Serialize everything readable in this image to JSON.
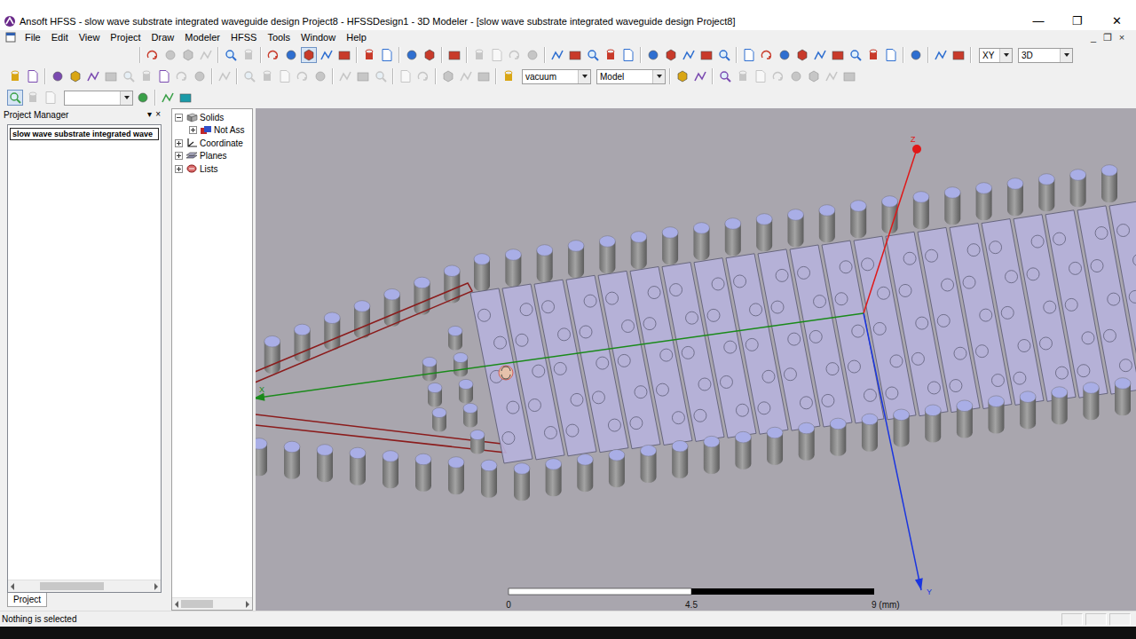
{
  "window": {
    "title": "Ansoft HFSS - slow wave substrate integrated waveguide design Project8 - HFSSDesign1 - 3D Modeler - [slow wave substrate integrated waveguide design Project8]",
    "controls": [
      "—",
      "❐",
      "✕"
    ]
  },
  "menu": {
    "items": [
      "File",
      "Edit",
      "View",
      "Project",
      "Draw",
      "Modeler",
      "HFSS",
      "Tools",
      "Window",
      "Help"
    ],
    "controls": [
      "_",
      "❐",
      "×"
    ]
  },
  "toolbars": [
    {
      "items": [
        {
          "kind": "separator"
        },
        {
          "kind": "button",
          "disabled": false,
          "pressed": false
        },
        {
          "kind": "button",
          "disabled": true,
          "pressed": false
        },
        {
          "kind": "button",
          "disabled": true,
          "pressed": false
        },
        {
          "kind": "button",
          "disabled": true,
          "pressed": false
        },
        {
          "kind": "separator"
        },
        {
          "kind": "button",
          "disabled": false,
          "pressed": false
        },
        {
          "kind": "button",
          "disabled": true,
          "pressed": false
        },
        {
          "kind": "separator"
        },
        {
          "kind": "button",
          "disabled": false,
          "pressed": false
        },
        {
          "kind": "button",
          "disabled": false,
          "pressed": false
        },
        {
          "kind": "button",
          "disabled": false,
          "pressed": true
        },
        {
          "kind": "button",
          "disabled": false,
          "pressed": false
        },
        {
          "kind": "button",
          "disabled": false,
          "pressed": false
        },
        {
          "kind": "separator"
        },
        {
          "kind": "button",
          "disabled": false,
          "pressed": false
        },
        {
          "kind": "button",
          "disabled": false,
          "pressed": false
        },
        {
          "kind": "separator"
        },
        {
          "kind": "button",
          "disabled": false,
          "pressed": false
        },
        {
          "kind": "button",
          "disabled": false,
          "pressed": false
        },
        {
          "kind": "separator"
        },
        {
          "kind": "button",
          "disabled": false,
          "pressed": false
        },
        {
          "kind": "separator"
        },
        {
          "kind": "button",
          "disabled": true,
          "pressed": false
        },
        {
          "kind": "button",
          "disabled": true,
          "pressed": false
        },
        {
          "kind": "button",
          "disabled": true,
          "pressed": false
        },
        {
          "kind": "button",
          "disabled": true,
          "pressed": false
        },
        {
          "kind": "separator"
        },
        {
          "kind": "button",
          "disabled": false,
          "pressed": false
        },
        {
          "kind": "button",
          "disabled": false,
          "pressed": false
        },
        {
          "kind": "button",
          "disabled": false,
          "pressed": false
        },
        {
          "kind": "button",
          "disabled": false,
          "pressed": false
        },
        {
          "kind": "button",
          "disabled": false,
          "pressed": false
        },
        {
          "kind": "separator"
        },
        {
          "kind": "button",
          "disabled": false,
          "pressed": false
        },
        {
          "kind": "button",
          "disabled": false,
          "pressed": false
        },
        {
          "kind": "button",
          "disabled": false,
          "pressed": false
        },
        {
          "kind": "button",
          "disabled": false,
          "pressed": false
        },
        {
          "kind": "button",
          "disabled": false,
          "pressed": false
        },
        {
          "kind": "separator"
        },
        {
          "kind": "button",
          "disabled": false,
          "pressed": false
        },
        {
          "kind": "button",
          "disabled": false,
          "pressed": false
        },
        {
          "kind": "button",
          "disabled": false,
          "pressed": false
        },
        {
          "kind": "button",
          "disabled": false,
          "pressed": false
        },
        {
          "kind": "button",
          "disabled": false,
          "pressed": false
        },
        {
          "kind": "button",
          "disabled": false,
          "pressed": false
        },
        {
          "kind": "button",
          "disabled": false,
          "pressed": false
        },
        {
          "kind": "button",
          "disabled": false,
          "pressed": false
        },
        {
          "kind": "button",
          "disabled": false,
          "pressed": false
        },
        {
          "kind": "separator"
        },
        {
          "kind": "button",
          "disabled": false,
          "pressed": false
        },
        {
          "kind": "separator"
        },
        {
          "kind": "button",
          "disabled": false,
          "pressed": false
        },
        {
          "kind": "button",
          "disabled": false,
          "pressed": false
        },
        {
          "kind": "separator"
        },
        {
          "kind": "dropdown",
          "value": "XY"
        },
        {
          "kind": "dropdown",
          "value": "3D"
        }
      ]
    },
    {
      "items": [
        {
          "kind": "button",
          "disabled": false,
          "pressed": false
        },
        {
          "kind": "button",
          "disabled": false,
          "pressed": false
        },
        {
          "kind": "separator"
        },
        {
          "kind": "button",
          "disabled": false,
          "pressed": false
        },
        {
          "kind": "button",
          "disabled": false,
          "pressed": false
        },
        {
          "kind": "button",
          "disabled": false,
          "pressed": false
        },
        {
          "kind": "button",
          "disabled": true,
          "pressed": false
        },
        {
          "kind": "button",
          "disabled": true,
          "pressed": false
        },
        {
          "kind": "button",
          "disabled": true,
          "pressed": false
        },
        {
          "kind": "button",
          "disabled": false,
          "pressed": false
        },
        {
          "kind": "button",
          "disabled": true,
          "pressed": false
        },
        {
          "kind": "button",
          "disabled": true,
          "pressed": false
        },
        {
          "kind": "separator"
        },
        {
          "kind": "button",
          "disabled": true,
          "pressed": false
        },
        {
          "kind": "separator"
        },
        {
          "kind": "button",
          "disabled": true,
          "pressed": false
        },
        {
          "kind": "button",
          "disabled": true,
          "pressed": false
        },
        {
          "kind": "button",
          "disabled": true,
          "pressed": false
        },
        {
          "kind": "button",
          "disabled": true,
          "pressed": false
        },
        {
          "kind": "button",
          "disabled": true,
          "pressed": false
        },
        {
          "kind": "separator"
        },
        {
          "kind": "button",
          "disabled": true,
          "pressed": false
        },
        {
          "kind": "button",
          "disabled": true,
          "pressed": false
        },
        {
          "kind": "button",
          "disabled": true,
          "pressed": false
        },
        {
          "kind": "separator"
        },
        {
          "kind": "button",
          "disabled": true,
          "pressed": false
        },
        {
          "kind": "button",
          "disabled": true,
          "pressed": false
        },
        {
          "kind": "separator"
        },
        {
          "kind": "button",
          "disabled": true,
          "pressed": false
        },
        {
          "kind": "button",
          "disabled": true,
          "pressed": false
        },
        {
          "kind": "button",
          "disabled": true,
          "pressed": false
        },
        {
          "kind": "separator"
        },
        {
          "kind": "button",
          "disabled": false,
          "pressed": false
        },
        {
          "kind": "dropdown",
          "value": "vacuum"
        },
        {
          "kind": "dropdown",
          "value": "Model"
        },
        {
          "kind": "separator"
        },
        {
          "kind": "button",
          "disabled": false,
          "pressed": false
        },
        {
          "kind": "button",
          "disabled": false,
          "pressed": false
        },
        {
          "kind": "separator"
        },
        {
          "kind": "button",
          "disabled": false,
          "pressed": false
        },
        {
          "kind": "button",
          "disabled": true,
          "pressed": false
        },
        {
          "kind": "button",
          "disabled": true,
          "pressed": false
        },
        {
          "kind": "button",
          "disabled": true,
          "pressed": false
        },
        {
          "kind": "button",
          "disabled": true,
          "pressed": false
        },
        {
          "kind": "button",
          "disabled": true,
          "pressed": false
        },
        {
          "kind": "button",
          "disabled": true,
          "pressed": false
        },
        {
          "kind": "button",
          "disabled": true,
          "pressed": false
        }
      ]
    },
    {
      "items": [
        {
          "kind": "button",
          "disabled": false,
          "pressed": true
        },
        {
          "kind": "button",
          "disabled": true,
          "pressed": false
        },
        {
          "kind": "button",
          "disabled": true,
          "pressed": false
        },
        {
          "kind": "dropdown",
          "value": ""
        },
        {
          "kind": "button",
          "disabled": false,
          "pressed": false
        },
        {
          "kind": "separator"
        },
        {
          "kind": "button",
          "disabled": false,
          "pressed": false
        },
        {
          "kind": "button",
          "disabled": false,
          "pressed": false
        }
      ]
    }
  ],
  "project_manager": {
    "title": "Project Manager",
    "controls": [
      "▾",
      "×"
    ],
    "items": [
      {
        "label": "slow wave substrate integrated wave",
        "selected": true
      }
    ],
    "tabs": [
      {
        "label": "Project",
        "selected": true
      }
    ]
  },
  "tree": [
    {
      "label": "Solids",
      "expanded": true,
      "children": [
        {
          "label": "Not Ass",
          "expanded": false,
          "children": []
        }
      ]
    },
    {
      "label": "Coordinate",
      "expanded": false,
      "children": []
    },
    {
      "label": "Planes",
      "expanded": false,
      "children": []
    },
    {
      "label": "Lists",
      "expanded": false,
      "children": []
    }
  ],
  "viewport": {
    "axes": [
      {
        "label": "Z",
        "kind": "dot",
        "color": "#e01818"
      },
      {
        "label": "X",
        "kind": "arrow",
        "color": "#1a8a1a"
      },
      {
        "label": "Y",
        "kind": "arrow",
        "color": "#1a35e0"
      }
    ],
    "scale": {
      "ticks": [
        "0",
        "4.5",
        "9 (mm)"
      ]
    }
  },
  "status_bar": {
    "text": "Nothing is selected"
  }
}
